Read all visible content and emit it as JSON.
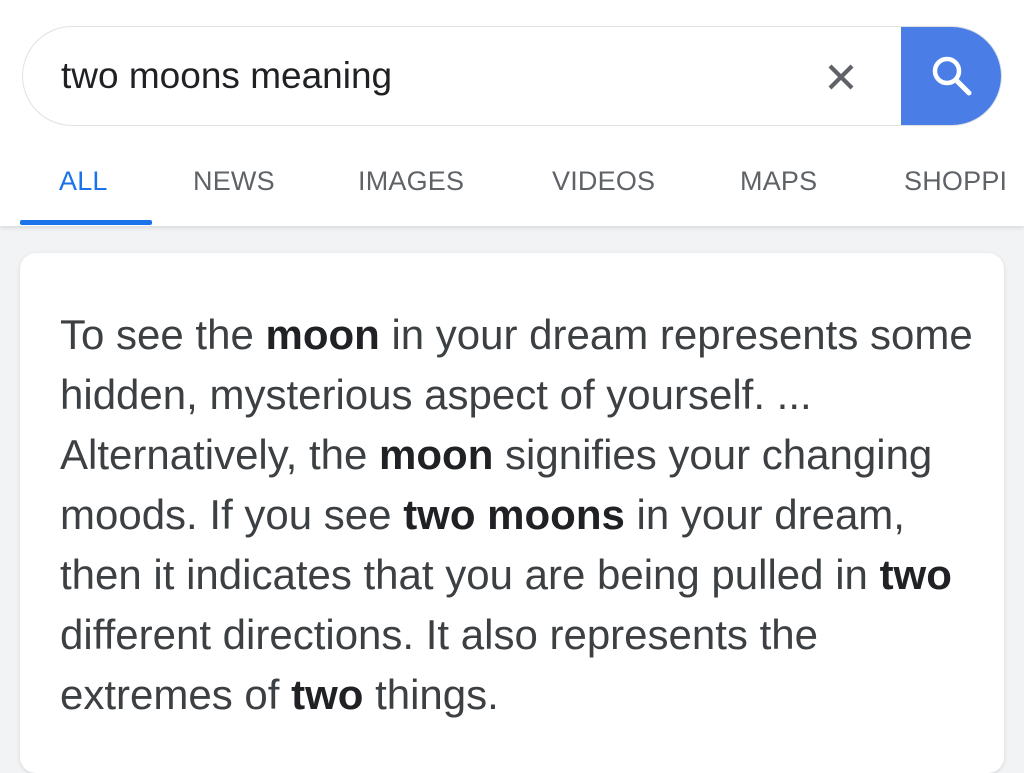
{
  "search": {
    "query": "two moons meaning",
    "clear_icon": "close-icon",
    "submit_icon": "search-icon",
    "accent_color": "#4a7ee6"
  },
  "tabs": [
    {
      "label": "ALL",
      "active": true
    },
    {
      "label": "NEWS",
      "active": false
    },
    {
      "label": "IMAGES",
      "active": false
    },
    {
      "label": "VIDEOS",
      "active": false
    },
    {
      "label": "MAPS",
      "active": false
    },
    {
      "label": "SHOPPI",
      "active": false
    }
  ],
  "snippet": {
    "segments": [
      {
        "text": "To see the ",
        "bold": false
      },
      {
        "text": "moon",
        "bold": true
      },
      {
        "text": " in your dream represents some hidden, mysterious aspect of yourself. ... Alternatively, the ",
        "bold": false
      },
      {
        "text": "moon",
        "bold": true
      },
      {
        "text": " signifies your changing moods. If you see ",
        "bold": false
      },
      {
        "text": "two moons",
        "bold": true
      },
      {
        "text": " in your dream, then it indicates that you are being pulled in ",
        "bold": false
      },
      {
        "text": "two",
        "bold": true
      },
      {
        "text": " different directions. It also represents the extremes of ",
        "bold": false
      },
      {
        "text": "two",
        "bold": true
      },
      {
        "text": " things.",
        "bold": false
      }
    ]
  },
  "colors": {
    "tab_active": "#1a73e8",
    "tab_inactive": "#5f6368",
    "text": "#3c4043"
  }
}
